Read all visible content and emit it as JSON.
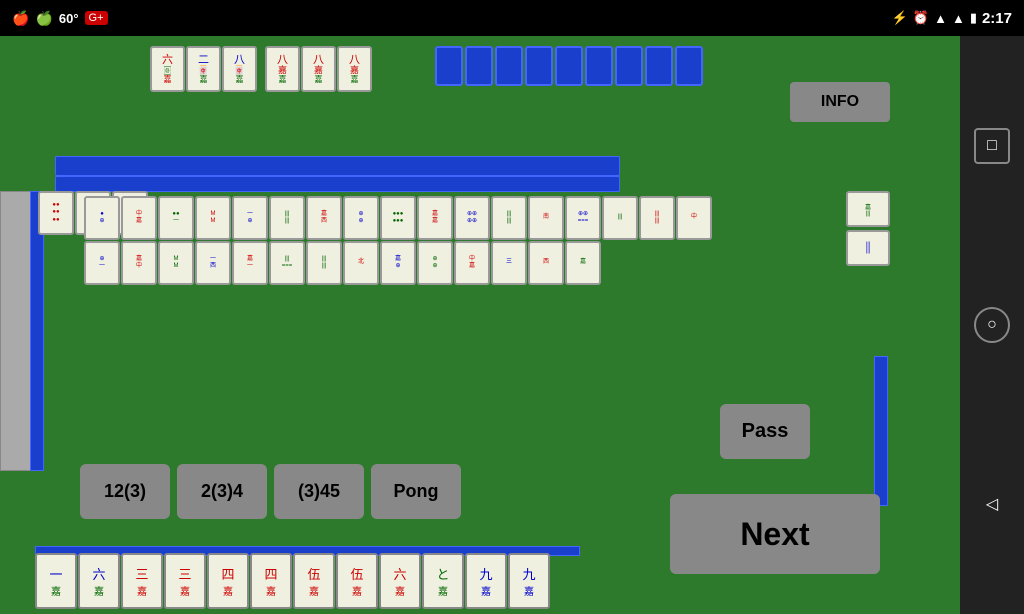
{
  "statusBar": {
    "temp": "60°",
    "time": "2:17",
    "icons": {
      "apple1": "🍎",
      "apple2": "🍏",
      "gplus": "G+",
      "bluetooth": "⚡",
      "alarm": "⏰",
      "signal": "▲",
      "battery": "🔋"
    }
  },
  "buttons": {
    "info": "INFO",
    "btn12_3": "12(3)",
    "btn2_3_4": "2(3)4",
    "btn_3_45": "(3)45",
    "pong": "Pong",
    "pass": "Pass",
    "next": "Next"
  },
  "nav": {
    "square": "□",
    "circle": "○",
    "back": "◁"
  },
  "tiles": {
    "opponentTopCount": 9,
    "playerHandSymbols": [
      "一",
      "六",
      "三",
      "三",
      "四",
      "四",
      "伍",
      "伍",
      "六",
      "と",
      "九",
      "九"
    ]
  }
}
